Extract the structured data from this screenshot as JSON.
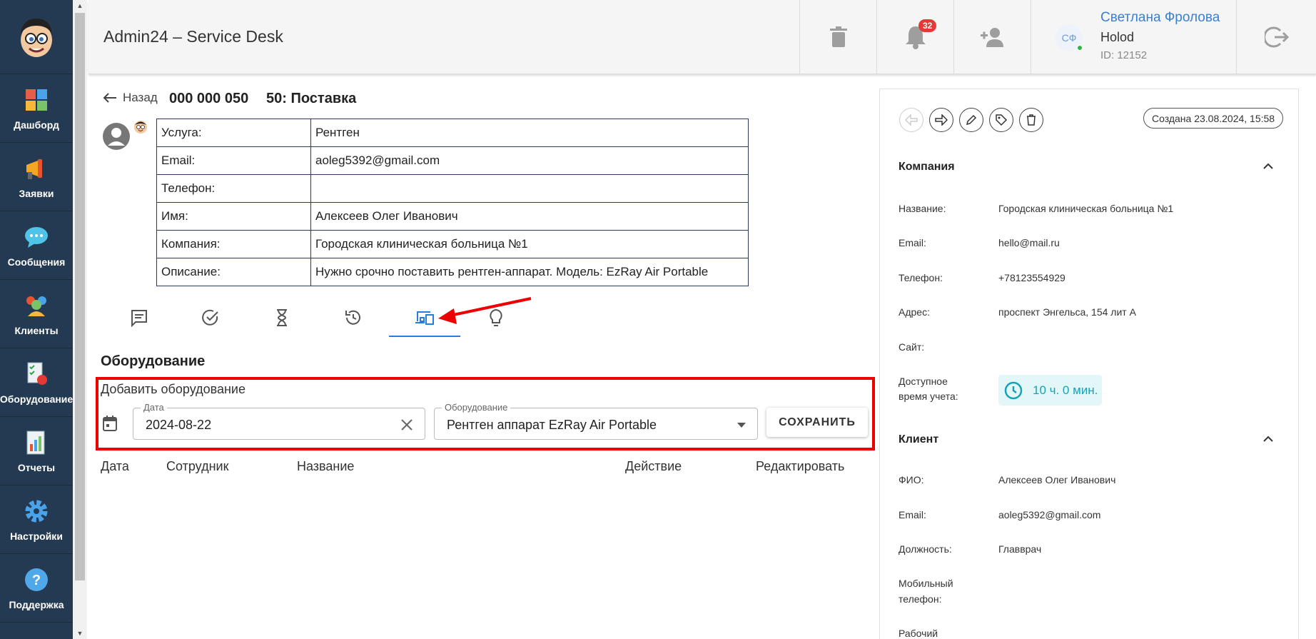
{
  "sidebar": {
    "items": [
      {
        "label": "Дашборд",
        "icon": "dashboard-icon"
      },
      {
        "label": "Заявки",
        "icon": "megaphone-icon"
      },
      {
        "label": "Сообщения",
        "icon": "chat-icon"
      },
      {
        "label": "Клиенты",
        "icon": "clients-icon"
      },
      {
        "label": "Оборудование",
        "icon": "equipment-icon"
      },
      {
        "label": "Отчеты",
        "icon": "reports-icon"
      },
      {
        "label": "Настройки",
        "icon": "gear-icon"
      },
      {
        "label": "Поддержка",
        "icon": "help-icon"
      }
    ]
  },
  "header": {
    "title": "Admin24 – Service Desk",
    "notifications_count": "32",
    "user": {
      "initials": "СФ",
      "name": "Светлана Фролова",
      "org": "Holod",
      "id": "ID: 12152"
    }
  },
  "ticket": {
    "back_label": "Назад",
    "number": "000 000 050",
    "title": "50: Поставка",
    "rows": [
      {
        "key": "Услуга:",
        "value": "Рентген"
      },
      {
        "key": "Email:",
        "value": "aoleg5392@gmail.com"
      },
      {
        "key": "Телефон:",
        "value": ""
      },
      {
        "key": "Имя:",
        "value": "Алексеев Олег Иванович"
      },
      {
        "key": "Компания:",
        "value": "Городская клиническая больница №1"
      },
      {
        "key": "Описание:",
        "value": "Нужно срочно поставить рентген-аппарат. Модель: EzRay Air Portable"
      }
    ]
  },
  "equipment": {
    "section_title": "Оборудование",
    "add_label": "Добавить оборудование",
    "date_label": "Дата",
    "date_value": "2024-08-22",
    "equipment_label": "Оборудование",
    "equipment_value": "Рентген аппарат EzRay Air Portable",
    "save_label": "СОХРАНИТЬ",
    "columns": [
      "Дата",
      "Сотрудник",
      "Название",
      "Действие",
      "Редактировать"
    ]
  },
  "panel": {
    "created": "Создана 23.08.2024, 15:58",
    "company": {
      "title": "Компания",
      "rows": [
        {
          "key": "Название:",
          "value": "Городская клиническая больница №1"
        },
        {
          "key": "Email:",
          "value": "hello@mail.ru"
        },
        {
          "key": "Телефон:",
          "value": "+78123554929"
        },
        {
          "key": "Адрес:",
          "value": "проспект Энгельса, 154 лит А"
        },
        {
          "key": "Сайт:",
          "value": ""
        }
      ],
      "time_key_1": "Доступное",
      "time_key_2": "время учета:",
      "time_value": "10 ч. 0 мин."
    },
    "client": {
      "title": "Клиент",
      "rows": [
        {
          "key": "ФИО:",
          "value": "Алексеев Олег Иванович"
        },
        {
          "key": "Email:",
          "value": "aoleg5392@gmail.com"
        },
        {
          "key": "Должность:",
          "value": "Главврач"
        }
      ],
      "mobile_key_1": "Мобильный",
      "mobile_key_2": "телефон:",
      "work_key": "Рабочий"
    }
  },
  "colors": {
    "sidebar": "#243a52",
    "accent": "#2b7bd8",
    "highlight": "#e00000",
    "teal": "#17a2b8",
    "badge": "#e53935"
  }
}
